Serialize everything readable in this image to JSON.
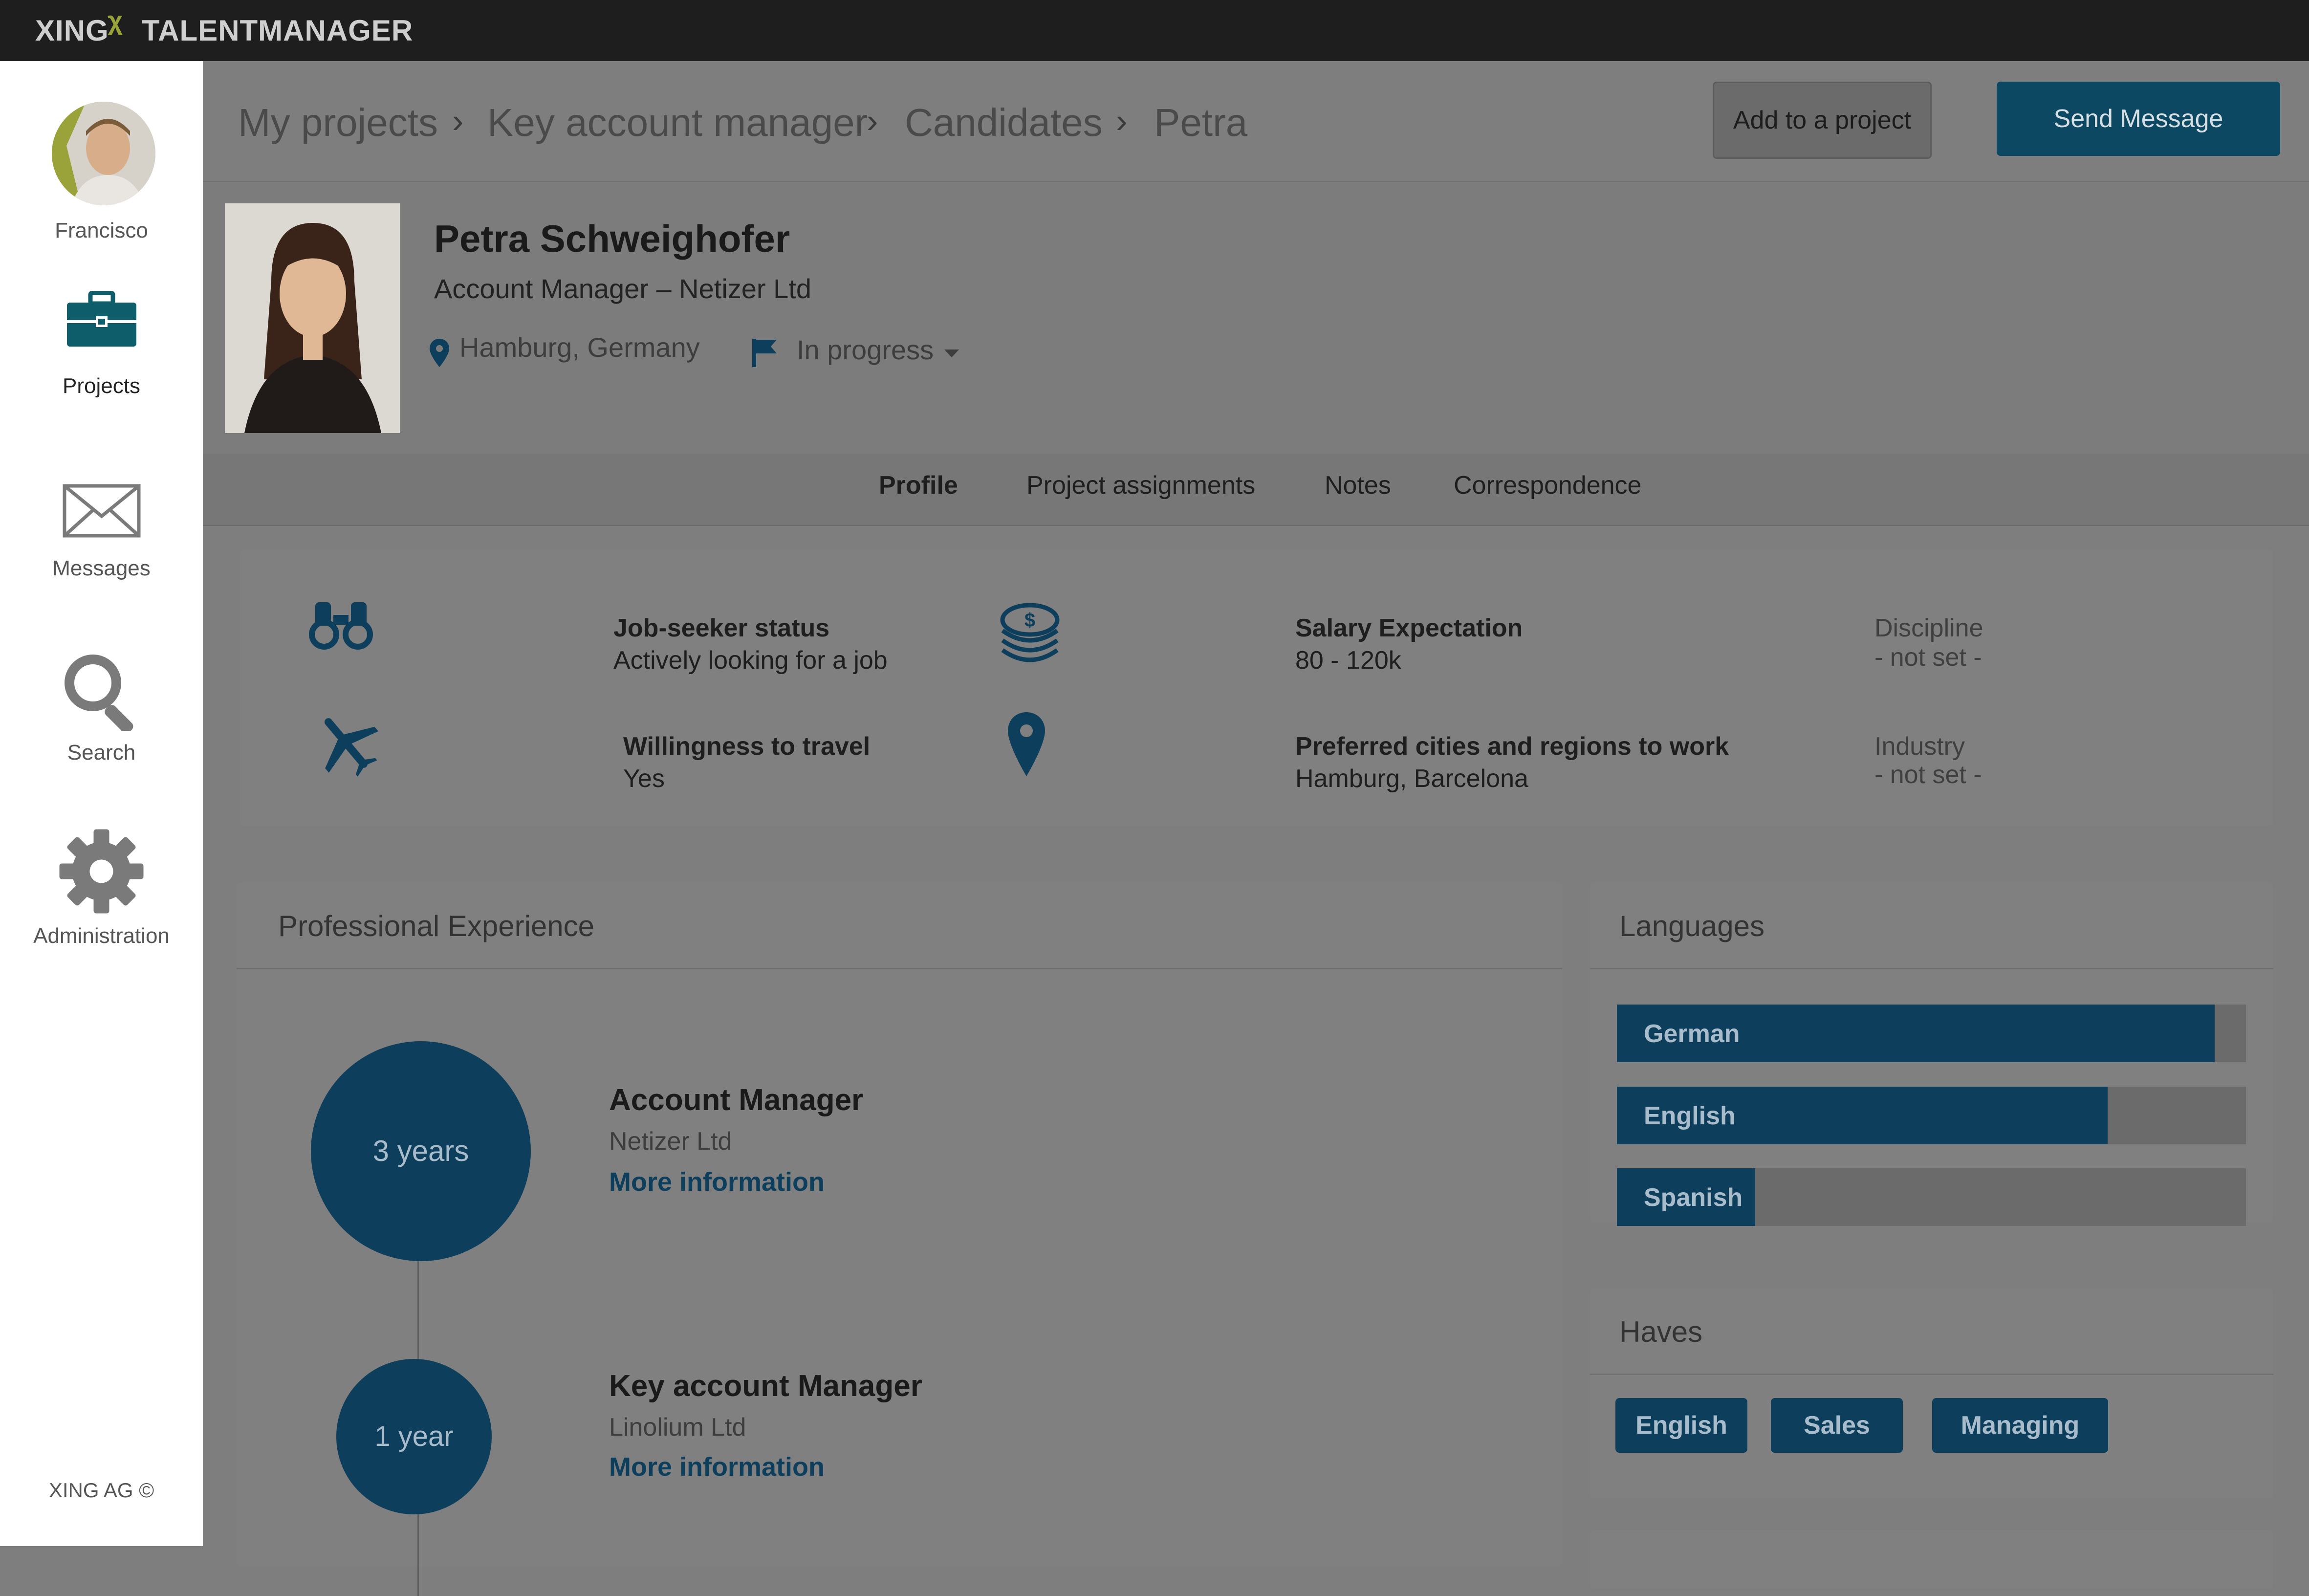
{
  "app": {
    "brand_left": "XING",
    "brand_mark": "χ",
    "brand_right": "TALENTMANAGER",
    "footer": "XING AG ©"
  },
  "colors": {
    "accent": "#0d3f5d",
    "button_primary": "#0d4863",
    "topbar": "#1e1e1e"
  },
  "sidebar": {
    "user_name": "Francisco",
    "items": [
      {
        "label": "Projects",
        "icon": "briefcase-icon",
        "active": true
      },
      {
        "label": "Messages",
        "icon": "envelope-icon"
      },
      {
        "label": "Search",
        "icon": "magnifier-icon"
      },
      {
        "label": "Administration",
        "icon": "gear-icon"
      }
    ]
  },
  "breadcrumb": [
    "My projects",
    "Key account manager",
    "Candidates",
    "Petra"
  ],
  "actions": {
    "add_to_project": "Add to a project",
    "send_message": "Send Message"
  },
  "candidate": {
    "name": "Petra Schweighofer",
    "title": "Account Manager – Netizer Ltd",
    "location": "Hamburg, Germany",
    "status": "In progress"
  },
  "tabs": [
    {
      "label": "Profile",
      "active": true
    },
    {
      "label": "Project assignments"
    },
    {
      "label": "Notes"
    },
    {
      "label": "Correspondence"
    }
  ],
  "summary": {
    "job_seeker_title": "Job-seeker status",
    "job_seeker_value": "Actively looking for a job",
    "travel_title": "Willingness to travel",
    "travel_value": "Yes",
    "salary_title": "Salary Expectation",
    "salary_value": "80 - 120k",
    "cities_title": "Preferred cities and regions to work",
    "cities_value": "Hamburg, Barcelona",
    "discipline_title": "Discipline",
    "discipline_value": "- not set -",
    "industry_title": "Industry",
    "industry_value": "- not set -"
  },
  "experience": {
    "heading": "Professional Experience",
    "items": [
      {
        "duration": "3 years",
        "title": "Account Manager",
        "company": "Netizer Ltd",
        "link": "More information"
      },
      {
        "duration": "1 year",
        "title": "Key account Manager",
        "company": "Linolium Ltd",
        "link": "More information"
      }
    ]
  },
  "languages": {
    "heading": "Languages",
    "items": [
      {
        "name": "German",
        "level": 0.95
      },
      {
        "name": "English",
        "level": 0.78
      },
      {
        "name": "Spanish",
        "level": 0.22
      }
    ]
  },
  "haves": {
    "heading": "Haves",
    "tags": [
      "English",
      "Sales",
      "Managing"
    ]
  }
}
